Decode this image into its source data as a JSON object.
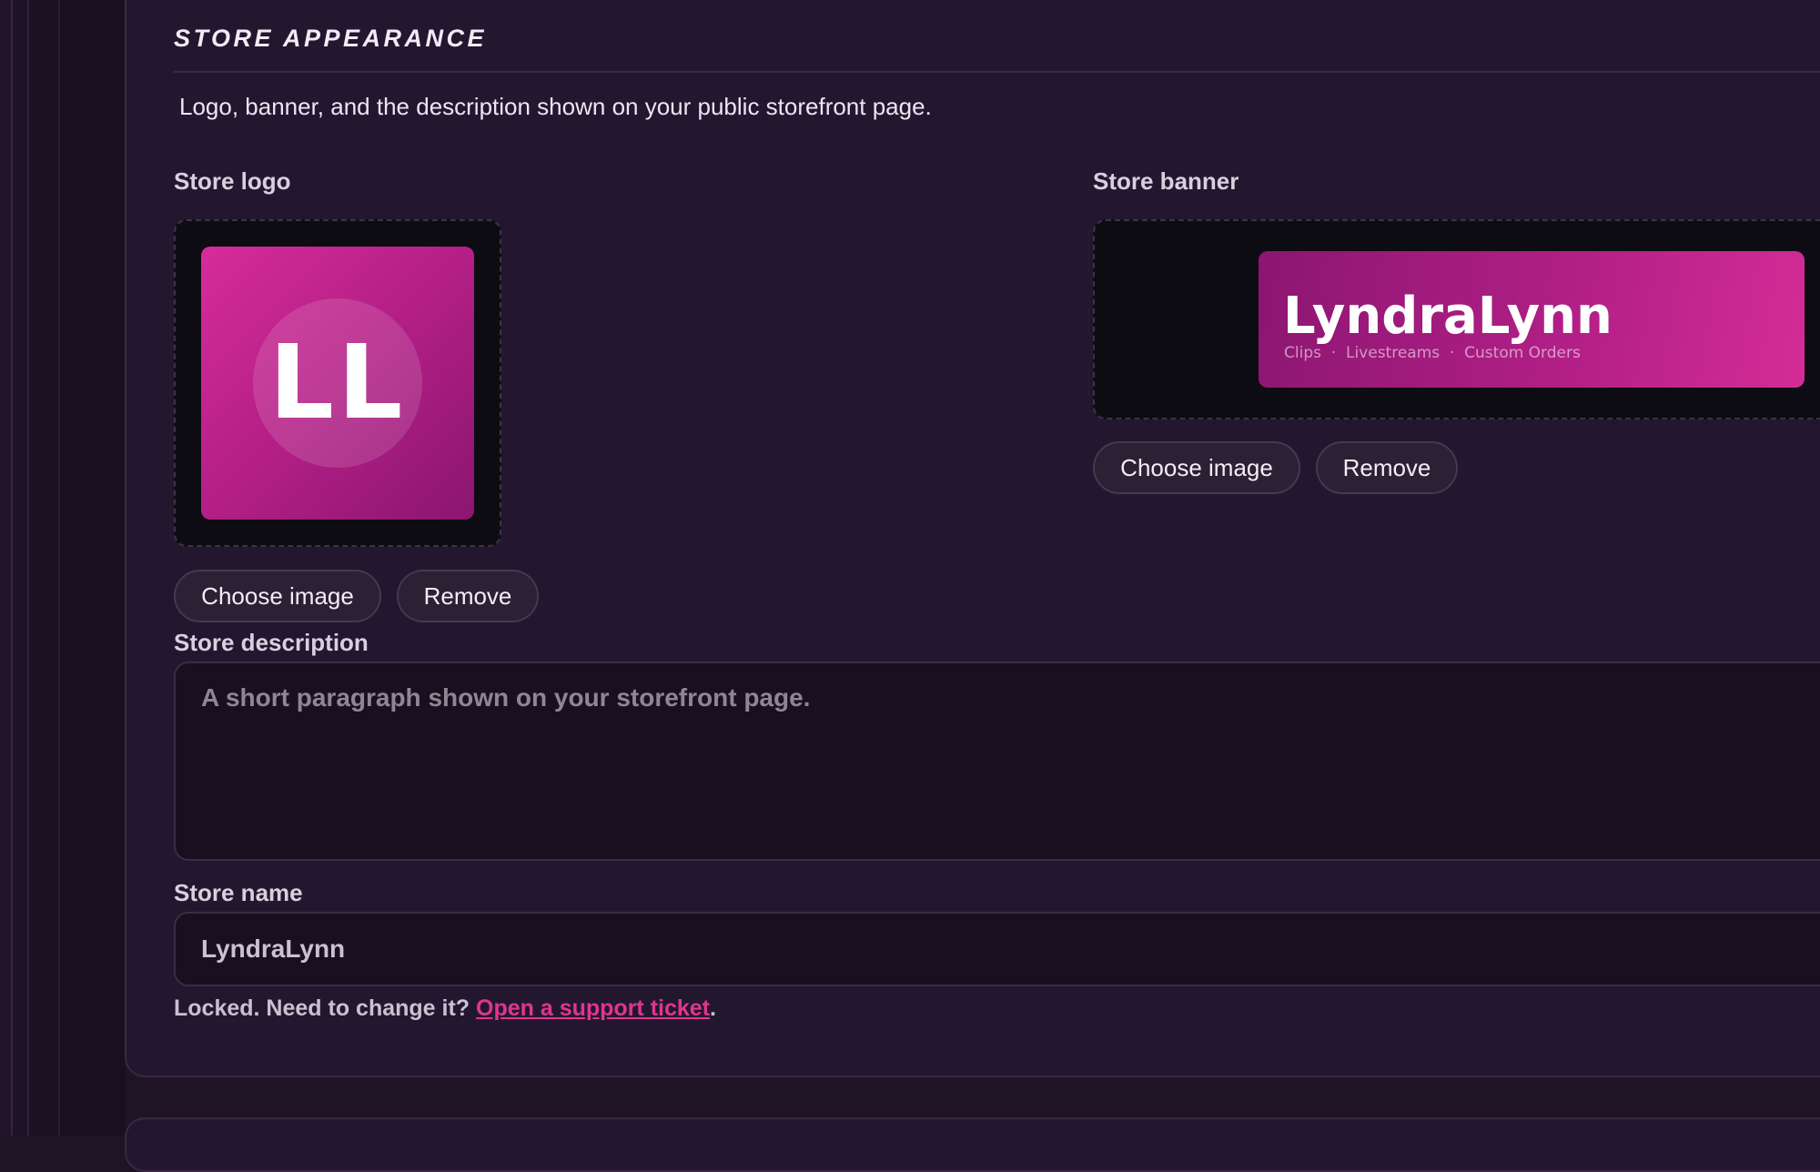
{
  "section": {
    "title": "STORE APPEARANCE",
    "description": "Logo, banner, and the description shown on your public storefront page."
  },
  "logo": {
    "label": "Store logo",
    "monogram": "LL",
    "choose_label": "Choose image",
    "remove_label": "Remove"
  },
  "banner": {
    "label": "Store banner",
    "store_name": "LyndraLynn",
    "tagline": "Clips  ·  Livestreams  ·  Custom Orders",
    "choose_label": "Choose image",
    "remove_label": "Remove"
  },
  "description_field": {
    "label": "Store description",
    "placeholder": "A short paragraph shown on your storefront page.",
    "value": ""
  },
  "name_field": {
    "label": "Store name",
    "value": "LyndraLynn",
    "note_prefix": "Locked. Need to change it?",
    "note_link": "Open a support ticket",
    "note_suffix": "."
  },
  "colors": {
    "accent": "#e0358f",
    "background": "#1e1425",
    "card": "#231730"
  }
}
